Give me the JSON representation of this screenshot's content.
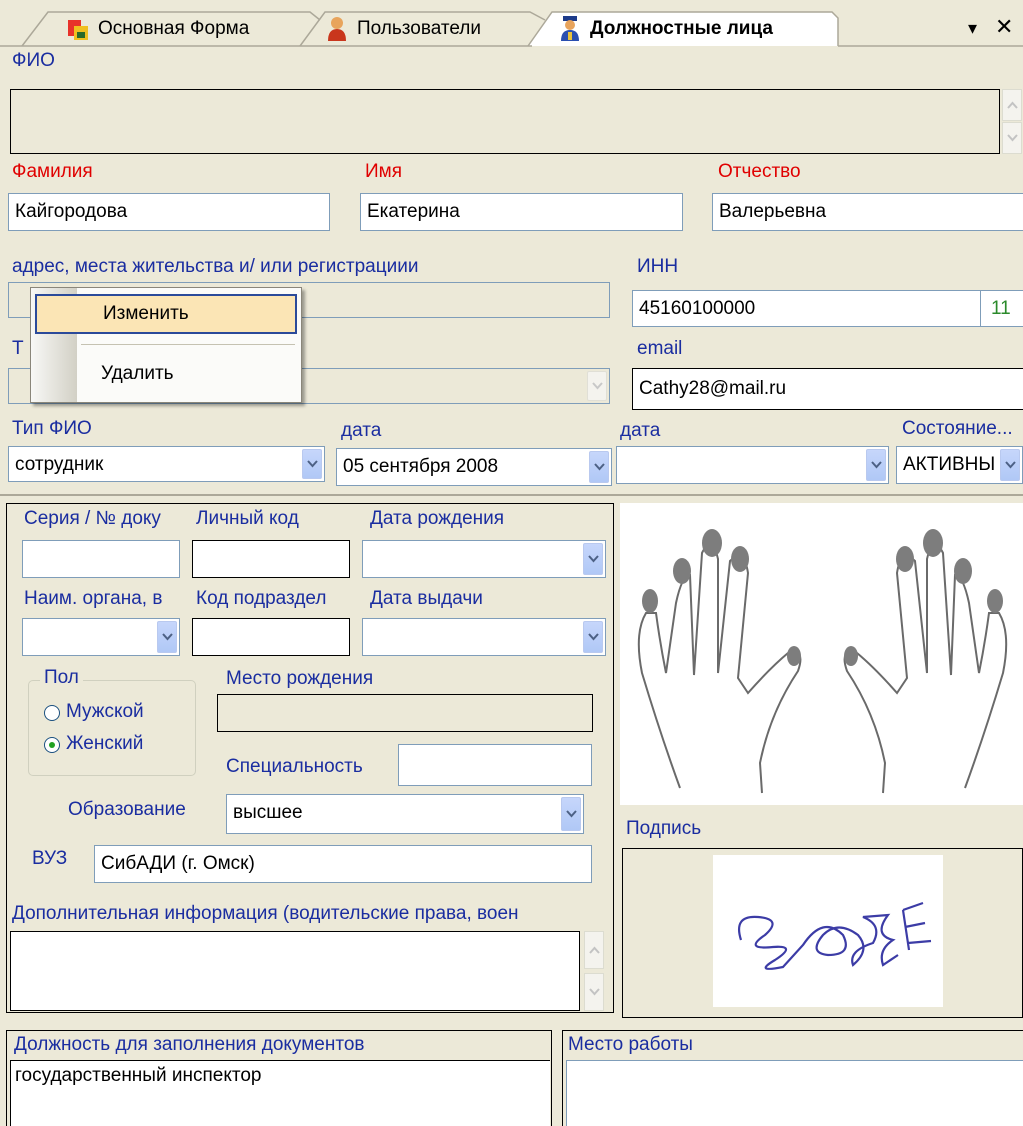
{
  "tabs": [
    {
      "label": "Основная Форма",
      "icon": "folder-app-icon"
    },
    {
      "label": "Пользователи",
      "icon": "user-icon"
    },
    {
      "label": "Должностные лица",
      "icon": "officer-icon"
    }
  ],
  "tab_controls": {
    "menu": "▾",
    "close": "✕"
  },
  "fio": {
    "label": "ФИО",
    "value": ""
  },
  "surname": {
    "label": "Фамилия",
    "value": "Кайгородова"
  },
  "name": {
    "label": "Имя",
    "value": "Екатерина"
  },
  "patronymic": {
    "label": "Отчество",
    "value": "Валерьевна"
  },
  "address": {
    "label": "адрес, места жительства и/ или регистрациии",
    "value": ""
  },
  "inn": {
    "label": "ИНН",
    "value": "45160100000",
    "check": "11"
  },
  "phone": {
    "label_partial": "Т"
  },
  "email": {
    "label": "email",
    "value": "Cathy28@mail.ru"
  },
  "context_menu": {
    "items": [
      "Изменить",
      "Удалить"
    ]
  },
  "fio_type": {
    "label": "Тип ФИО",
    "value": "сотрудник"
  },
  "date1": {
    "label": "дата",
    "value": "05 сентября 2008"
  },
  "date2": {
    "label": "дата",
    "value": ""
  },
  "state": {
    "label": "Состояние...",
    "value": "АКТИВНЫ"
  },
  "doc": {
    "series_label": "Серия / № доку",
    "personal_code_label": "Личный код",
    "birth_date_label": "Дата рождения",
    "issuer_label": "Наим. органа, в",
    "subdivision_code_label": "Код подраздел",
    "issue_date_label": "Дата выдачи"
  },
  "gender": {
    "label": "Пол",
    "options": [
      "Мужской",
      "Женский"
    ],
    "selected": "Женский"
  },
  "birthplace": {
    "label": "Место рождения",
    "value": ""
  },
  "specialty": {
    "label": "Специальность",
    "value": ""
  },
  "education": {
    "label": "Образование",
    "value": "высшее"
  },
  "university": {
    "label": "ВУЗ",
    "value": "СибАДИ (г. Омск)"
  },
  "extra_info": {
    "label": "Дополнительная информация (водительские права, воен",
    "value": ""
  },
  "signature": {
    "label": "Подпись"
  },
  "position": {
    "label": "Должность для заполнения документов",
    "value": "государственный инспектор"
  },
  "workplace": {
    "label": "Место работы",
    "value": ""
  },
  "colors": {
    "accent_red": "#e00000",
    "background": "#ece9d8",
    "menu_highlight": "#fbe5b5"
  }
}
